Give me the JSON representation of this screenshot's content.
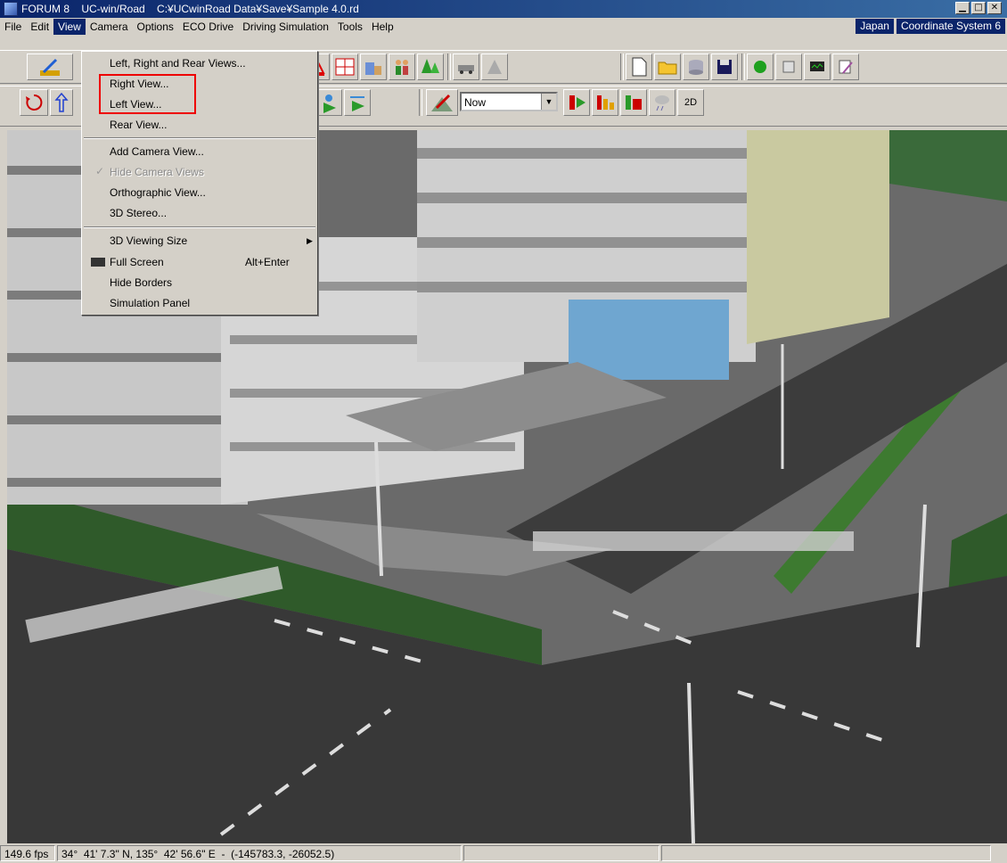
{
  "window": {
    "app": "FORUM 8",
    "product": "UC-win/Road",
    "path": "C:¥UCwinRoad Data¥Save¥Sample 4.0.rd",
    "min_glyph": "▁",
    "max_glyph": "□",
    "close_glyph": "✕"
  },
  "menubar": {
    "items": [
      {
        "label": "File"
      },
      {
        "label": "Edit"
      },
      {
        "label": "View"
      },
      {
        "label": "Camera"
      },
      {
        "label": "Options"
      },
      {
        "label": "ECO Drive"
      },
      {
        "label": "Driving Simulation"
      },
      {
        "label": "Tools"
      },
      {
        "label": "Help"
      }
    ],
    "region": "Japan",
    "coordinate_system": "Coordinate System 6"
  },
  "toolbar2": {
    "time_select": "Now",
    "mode_label": "2D"
  },
  "view_menu": {
    "items": {
      "left_right_rear": "Left, Right and Rear Views...",
      "right_view": "Right View...",
      "left_view": "Left View...",
      "rear_view": "Rear View...",
      "add_camera": "Add Camera View...",
      "hide_camera": "Hide Camera Views",
      "orthographic": "Orthographic View...",
      "stereo": "3D Stereo...",
      "viewing_size": "3D Viewing Size",
      "full_screen": "Full Screen",
      "full_screen_shortcut": "Alt+Enter",
      "hide_borders": "Hide Borders",
      "simulation_panel": "Simulation Panel"
    }
  },
  "statusbar": {
    "fps": "149.6 fps",
    "coords": "34°  41' 7.3\" N, 135°  42' 56.6\" E  -  (-145783.3, -26052.5)"
  },
  "colors": {
    "accent": "#0a246a",
    "highlight_box": "#e00000"
  }
}
